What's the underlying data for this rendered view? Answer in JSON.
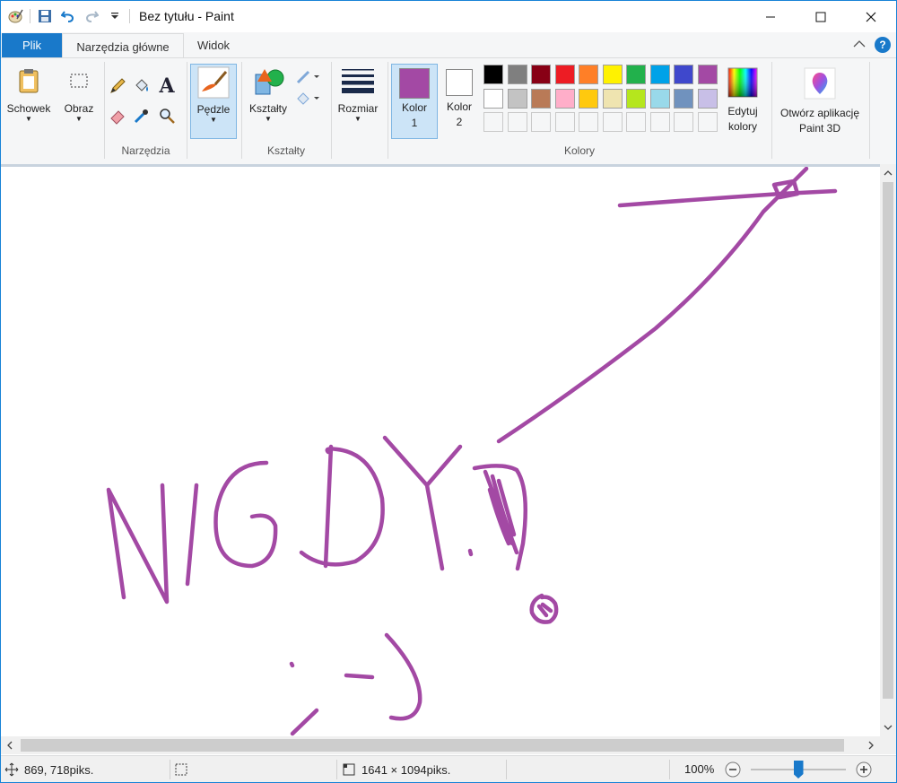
{
  "titlebar": {
    "title": "Bez tytułu - Paint",
    "minimize_icon": "minimize-icon",
    "maximize_icon": "maximize-icon",
    "close_icon": "close-icon"
  },
  "tabs": {
    "file": "Plik",
    "home": "Narzędzia główne",
    "view": "Widok"
  },
  "ribbon": {
    "clipboard_label": "Schowek",
    "image_label": "Obraz",
    "tools_group": "Narzędzia",
    "brushes_label": "Pędzle",
    "shapes_label": "Kształty",
    "shapes_group": "Kształty",
    "size_label": "Rozmiar",
    "color1_label_a": "Kolor",
    "color1_label_b": "1",
    "color2_label_a": "Kolor",
    "color2_label_b": "2",
    "colors_group": "Kolory",
    "edit_colors_a": "Edytuj",
    "edit_colors_b": "kolory",
    "paint3d_a": "Otwórz aplikację",
    "paint3d_b": "Paint 3D"
  },
  "colors": {
    "color1": "#a349a4",
    "color2": "#ffffff",
    "palette_row1": [
      "#000000",
      "#7f7f7f",
      "#880015",
      "#ed1c24",
      "#ff7f27",
      "#fff200",
      "#22b14c",
      "#00a2e8",
      "#3f48cc",
      "#a349a4"
    ],
    "palette_row2": [
      "#ffffff",
      "#c3c3c3",
      "#b97a57",
      "#ffaec9",
      "#ffc90e",
      "#efe4b0",
      "#b5e61d",
      "#99d9ea",
      "#7092be",
      "#c8bfe7"
    ],
    "stroke": "#a349a4"
  },
  "status": {
    "cursor_pos": "869, 718piks.",
    "canvas_size": "1641 × 1094piks.",
    "zoom": "100%",
    "zoom_level": 1.0
  }
}
